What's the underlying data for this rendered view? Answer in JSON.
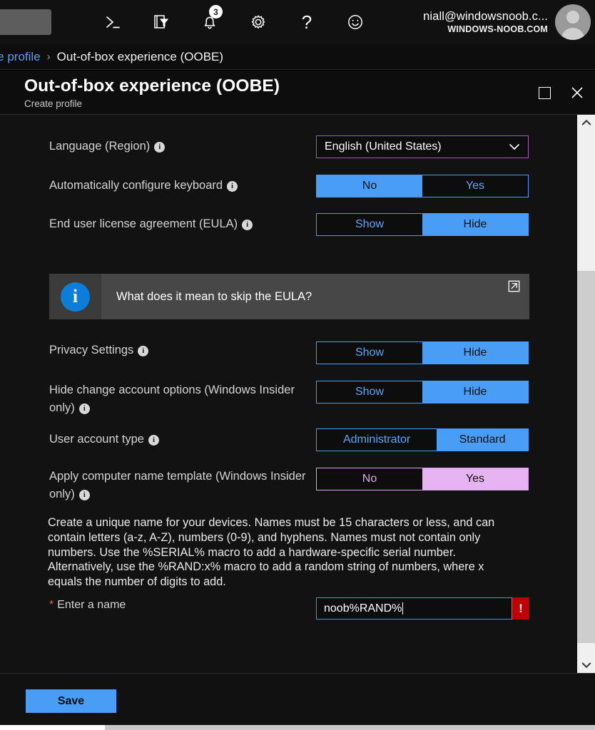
{
  "topbar": {
    "search_stub": "",
    "icons": [
      {
        "name": "cloud-shell-icon",
        "label": ">_"
      },
      {
        "name": "directories-filter-icon",
        "label": ""
      },
      {
        "name": "notifications-bell-icon",
        "label": "",
        "badge": "3"
      },
      {
        "name": "settings-gear-icon",
        "label": ""
      },
      {
        "name": "help-question-icon",
        "label": "?"
      },
      {
        "name": "feedback-smiley-icon",
        "label": ""
      }
    ],
    "account": {
      "upn": "niall@windowsnoob.c...",
      "tenant": "WINDOWS-NOOB.COM"
    }
  },
  "breadcrumb": {
    "parent": "ate profile",
    "separator": "›",
    "current": "Out-of-box experience (OOBE)"
  },
  "blade": {
    "title": "Out-of-box experience (OOBE)",
    "subtitle": "Create profile",
    "maximize_label": "",
    "close_label": "✕"
  },
  "form": {
    "language": {
      "label": "Language (Region)",
      "value": "English (United States)",
      "chevron": "∨"
    },
    "auto_keyboard": {
      "label": "Automatically configure keyboard",
      "options": [
        "No",
        "Yes"
      ],
      "selected": "No"
    },
    "eula": {
      "label": "End user license agreement (EULA)",
      "options": [
        "Show",
        "Hide"
      ],
      "selected": "Hide"
    },
    "privacy": {
      "label": "Privacy Settings",
      "options": [
        "Show",
        "Hide"
      ],
      "selected": "Hide"
    },
    "hide_change_account": {
      "label": "Hide change account options (Windows Insider only)",
      "options": [
        "Show",
        "Hide"
      ],
      "selected": "Hide"
    },
    "user_account_type": {
      "label": "User account type",
      "options": [
        "Administrator",
        "Standard"
      ],
      "selected": "Standard"
    },
    "computer_name_template": {
      "label": "Apply computer name template (Windows Insider only)",
      "options": [
        "No",
        "Yes"
      ],
      "selected": "Yes"
    },
    "name_description": "Create a unique name for your devices. Names must be 15 characters or less, and can contain letters (a-z, A-Z), numbers (0-9), and hyphens. Names must not contain only numbers. Use the %SERIAL% macro to add a hardware-specific serial number. Alternatively, use the %RAND:x% macro to add a random string of numbers, where x equals the number of digits to add.",
    "name_field": {
      "required_marker": "*",
      "label": "Enter a name",
      "value": "noob%RAND%",
      "placeholder": "",
      "error_marker": "!"
    },
    "info_text": "Info"
  },
  "banner": {
    "icon": "i",
    "text": "What does it mean to skip the EULA?",
    "external_link": "open-in-new"
  },
  "footer": {
    "save_label": "Save"
  },
  "scrollbar": {
    "up_arrow": "∧",
    "down_arrow": "∨"
  },
  "colors": {
    "accent_blue": "#4a9df5",
    "violet": "#e6b4f0",
    "error_red": "#c00000",
    "info_blue": "#0b7dda",
    "link_blue": "#5b9bf8"
  }
}
